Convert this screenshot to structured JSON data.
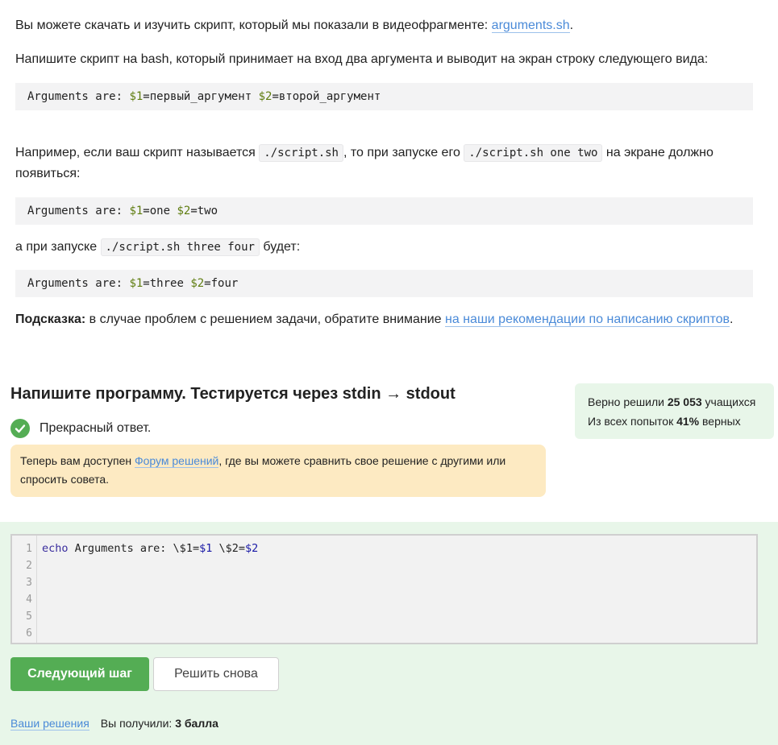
{
  "lesson": {
    "p1_text": "Вы можете скачать и изучить скрипт, который мы показали в видеофрагменте: ",
    "p1_link": "arguments.sh",
    "p1_end": ".",
    "p2": "Напишите скрипт на bash, который принимает на вход два аргумента и выводит на экран строку следующего вида:",
    "code1": {
      "prefix": "Arguments are: ",
      "v1": "$1",
      "a1": "=первый_аргумент ",
      "v2": "$2",
      "a2": "=второй_аргумент"
    },
    "p3_a": "Например, если ваш скрипт называется ",
    "p3_code1": "./script.sh",
    "p3_b": ", то при запуске его ",
    "p3_code2": "./script.sh one two",
    "p3_c": " на экране должно появиться:",
    "code2": {
      "prefix": "Arguments are: ",
      "v1": "$1",
      "a1": "=one ",
      "v2": "$2",
      "a2": "=two"
    },
    "p4_a": "а при запуске ",
    "p4_code": "./script.sh three four",
    "p4_b": " будет:",
    "code3": {
      "prefix": "Arguments are: ",
      "v1": "$1",
      "a1": "=three ",
      "v2": "$2",
      "a2": "=four"
    },
    "hint_bold": "Подсказка:",
    "hint_text": " в случае проблем с решением задачи, обратите внимание ",
    "hint_link": "на наши рекомендации по написанию скриптов",
    "hint_end": "."
  },
  "task": {
    "title": "Напишите программу. Тестируется через stdin → stdout",
    "success": "Прекрасный ответ.",
    "notice_a": "Теперь вам доступен ",
    "notice_link": "Форум решений",
    "notice_b": ", где вы можете сравнить свое решение с другими или спросить совета."
  },
  "stats": {
    "solved_a": "Верно решили ",
    "solved_count": "25 053",
    "solved_b": " учащихся",
    "attempts_a": "Из всех попыток ",
    "attempts_pct": "41%",
    "attempts_b": " верных"
  },
  "editor": {
    "line_numbers": [
      "1",
      "2",
      "3",
      "4",
      "5",
      "6"
    ],
    "line1": {
      "kw": "echo",
      "t1": " Arguments are: \\$1=",
      "v1": "$1",
      "t2": " \\$2=",
      "v2": "$2"
    }
  },
  "buttons": {
    "next": "Следующий шаг",
    "retry": "Решить снова"
  },
  "footer": {
    "solutions_link": "Ваши решения",
    "score_label": "Вы получили: ",
    "score_value": "3 балла"
  },
  "colors": {
    "accent_green": "#54ad54",
    "link_blue": "#4a8ad8",
    "stats_bg": "#e8f6e9",
    "notice_bg": "#fdeac2"
  }
}
